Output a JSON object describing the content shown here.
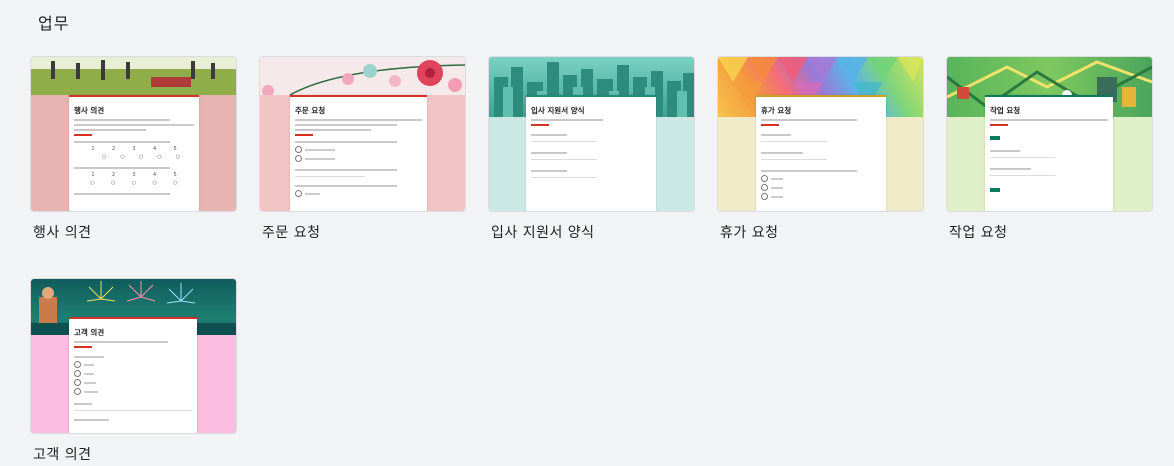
{
  "section": {
    "title": "업무"
  },
  "templates": [
    {
      "label": "행사 의견",
      "form_title": "행사 의견",
      "accent": "#d93025",
      "lower_color": "#e8b4b1",
      "scale_numbers": [
        "1",
        "2",
        "3",
        "4",
        "5"
      ]
    },
    {
      "label": "주문 요청",
      "form_title": "주문 요청",
      "accent": "#d93025",
      "lower_color": "#f2c5c5"
    },
    {
      "label": "입사 지원서 양식",
      "form_title": "입사 지원서 양식",
      "accent": "#1a8f7e",
      "lower_color": "#cbe9e4"
    },
    {
      "label": "휴가 요청",
      "form_title": "휴가 요청",
      "accent": "#c9a227",
      "lower_color": "#f0ebc7"
    },
    {
      "label": "작업 요청",
      "form_title": "작업 요청",
      "accent": "#0b7a5f",
      "lower_color": "#dff0c9"
    },
    {
      "label": "고객 의견",
      "form_title": "고객 의견",
      "accent": "#d93025",
      "lower_color": "#fbbde0"
    }
  ]
}
